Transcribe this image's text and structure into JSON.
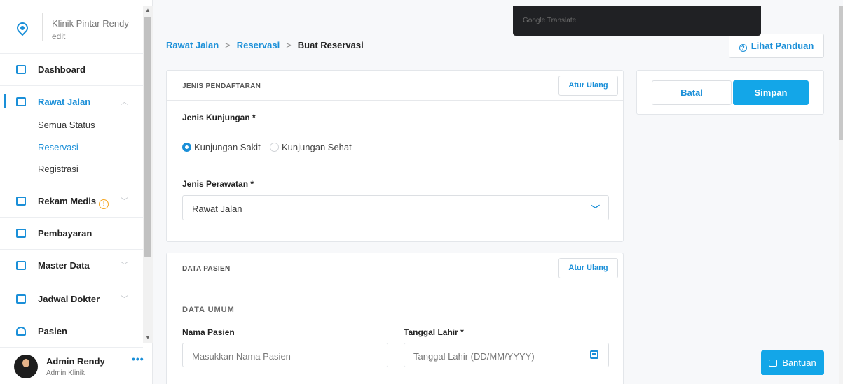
{
  "sidebar": {
    "clinic_name": "Klinik Pintar Rendy",
    "clinic_edit": "edit",
    "items": [
      {
        "label": "Dashboard"
      },
      {
        "label": "Rawat Jalan",
        "sub": [
          "Semua Status",
          "Reservasi",
          "Registrasi"
        ]
      },
      {
        "label": "Rekam Medis"
      },
      {
        "label": "Pembayaran"
      },
      {
        "label": "Master Data"
      },
      {
        "label": "Jadwal Dokter"
      },
      {
        "label": "Pasien"
      }
    ],
    "user": {
      "name": "Admin Rendy",
      "role": "Admin Klinik"
    }
  },
  "overlay": {
    "google_translate": "Google Translate"
  },
  "breadcrumb": {
    "level1": "Rawat Jalan",
    "level2": "Reservasi",
    "current": "Buat Reservasi",
    "separator": ">"
  },
  "guide_button": "Lihat Panduan",
  "registration": {
    "title": "JENIS PENDAFTARAN",
    "reset": "Atur Ulang",
    "visit_type_label": "Jenis Kunjungan *",
    "visit_options": [
      "Kunjungan Sakit",
      "Kunjungan Sehat"
    ],
    "visit_selected": "Kunjungan Sakit",
    "care_type_label": "Jenis Perawatan *",
    "care_type_value": "Rawat Jalan"
  },
  "patient": {
    "title": "DATA PASIEN",
    "reset": "Atur Ulang",
    "section": "DATA UMUM",
    "name_label": "Nama Pasien",
    "name_placeholder": "Masukkan Nama Pasien",
    "dob_label": "Tanggal Lahir *",
    "dob_placeholder": "Tanggal Lahir (DD/MM/YYYY)"
  },
  "actions": {
    "cancel": "Batal",
    "save": "Simpan"
  },
  "help_button": "Bantuan",
  "colors": {
    "accent": "#1a8fd8",
    "primary_button": "#13a6e8",
    "warning": "#f5a623"
  }
}
